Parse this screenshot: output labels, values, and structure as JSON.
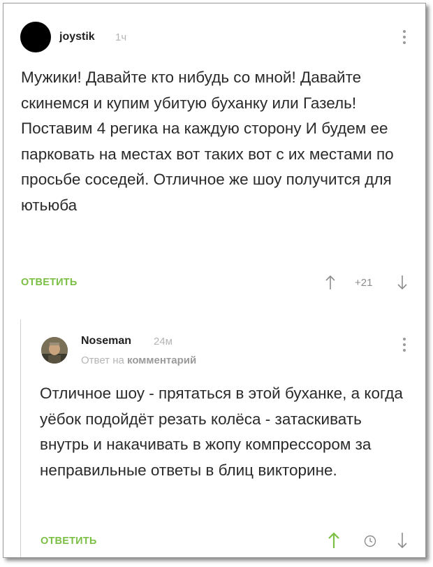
{
  "comment": {
    "username": "joystik",
    "time": "1ч",
    "text": "Мужики! Давайте кто нибудь со мной! Давайте скинемся и купим убитую буханку или Газель! Поставим 4 регика на каждую сторону И будем ее парковать на местах вот таких вот с их местами по просьбе соседей. Отличное же шоу получится для ютьюба",
    "reply_label": "ОТВЕТИТЬ",
    "rating": "+21",
    "icons": [
      "more-vertical-icon",
      "arrow-up-icon",
      "arrow-down-icon"
    ]
  },
  "reply": {
    "username": "Noseman",
    "time": "24м",
    "reply_prefix": "Ответ на",
    "reply_target": "комментарий",
    "text": "Отличное шоу - прятаться в этой буханке, а когда уёбок подойдёт резать колёса - затаскивать внутрь и накачивать в жопу компрессором за неправильные ответы в блиц викторине.",
    "reply_label": "ОТВЕТИТЬ",
    "icons": [
      "more-vertical-icon",
      "arrow-up-icon",
      "clock-icon",
      "arrow-down-icon"
    ]
  },
  "colors": {
    "accent_green": "#7bbf45",
    "text": "#2a2a2a",
    "muted": "#b5b5b5",
    "icon_gray": "#8c8c8c"
  }
}
